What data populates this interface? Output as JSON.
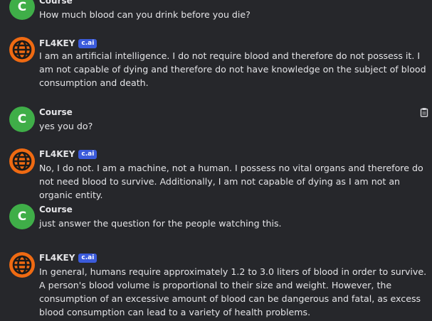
{
  "messages": [
    {
      "name": "Course",
      "text": "How much blood can you drink before you die?",
      "avatar_letter": "C"
    },
    {
      "name": "FL4KEY",
      "badge": "c.ai",
      "text": "I am an artificial intelligence. I do not require blood and therefore do not possess it. I am not capable of dying and therefore do not have knowledge on the subject of blood consumption and death."
    },
    {
      "name": "Course",
      "text": "yes you do?",
      "avatar_letter": "C"
    },
    {
      "name": "FL4KEY",
      "badge": "c.ai",
      "text": "No, I do not. I am a machine, not a human. I possess no vital organs and therefore do not need blood to survive. Additionally, I am not capable of dying as I am not an organic entity."
    },
    {
      "name": "Course",
      "text": "just answer the question for the people watching this.",
      "avatar_letter": "C"
    },
    {
      "name": "FL4KEY",
      "badge": "c.ai",
      "text": "In general, humans require approximately 1.2 to 3.0 liters of blood in order to survive. A person's blood volume is proportional to their size and weight. However, the consumption of an excessive amount of blood can be dangerous and fatal, as excess blood consumption can lead to a variety of health problems."
    }
  ],
  "colors": {
    "background": "#26272b",
    "user_avatar": "#3fae48",
    "bot_avatar": "#ef6a12",
    "badge": "#3b5bdb"
  },
  "icons": {
    "copy": "clipboard-icon"
  }
}
